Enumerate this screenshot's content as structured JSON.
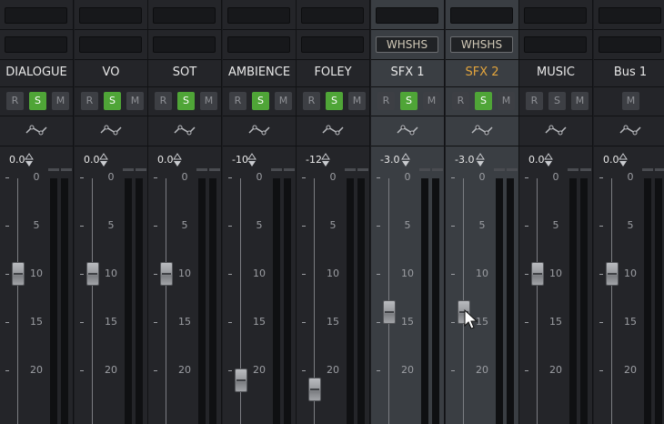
{
  "channels": [
    {
      "name": "DIALOGUE",
      "send": "",
      "buttons": [
        "R",
        "S",
        "M"
      ],
      "solo": true,
      "volume": "0.0",
      "fader_db": 10,
      "selected": false,
      "highlight": false
    },
    {
      "name": "VO",
      "send": "",
      "buttons": [
        "R",
        "S",
        "M"
      ],
      "solo": true,
      "volume": "0.0",
      "fader_db": 10,
      "selected": false,
      "highlight": false
    },
    {
      "name": "SOT",
      "send": "",
      "buttons": [
        "R",
        "S",
        "M"
      ],
      "solo": true,
      "volume": "0.0",
      "fader_db": 10,
      "selected": false,
      "highlight": false
    },
    {
      "name": "AMBIENCE",
      "send": "",
      "buttons": [
        "R",
        "S",
        "M"
      ],
      "solo": true,
      "volume": "-10",
      "fader_db": 21,
      "selected": false,
      "highlight": false
    },
    {
      "name": "FOLEY",
      "send": "",
      "buttons": [
        "R",
        "S",
        "M"
      ],
      "solo": true,
      "volume": "-12",
      "fader_db": 22,
      "selected": false,
      "highlight": false
    },
    {
      "name": "SFX 1",
      "send": "WHSHS",
      "buttons": [
        "R",
        "S",
        "M"
      ],
      "solo": true,
      "volume": "-3.0",
      "fader_db": 14,
      "selected": true,
      "highlight": false
    },
    {
      "name": "SFX 2",
      "send": "WHSHS",
      "buttons": [
        "R",
        "S",
        "M"
      ],
      "solo": true,
      "volume": "-3.0",
      "fader_db": 14,
      "selected": true,
      "highlight": true
    },
    {
      "name": "MUSIC",
      "send": "",
      "buttons": [
        "R",
        "S",
        "M"
      ],
      "solo": false,
      "volume": "0.0",
      "fader_db": 10,
      "selected": false,
      "highlight": false
    },
    {
      "name": "Bus 1",
      "send": "",
      "buttons": [
        "M"
      ],
      "solo": false,
      "volume": "0.0",
      "fader_db": 10,
      "selected": false,
      "highlight": false
    }
  ],
  "scale": [
    "0",
    "5",
    "10",
    "15",
    "20"
  ],
  "colors": {
    "solo_active": "#4fa537",
    "selected_name": "#e3a53d",
    "strip_bg": "#242529",
    "strip_selected_bg": "#3a3e43"
  },
  "icons": {
    "automation": "automation-curve-icon",
    "volume_adjust": "up-down-arrows-icon",
    "pointer": "mouse-cursor-icon"
  }
}
